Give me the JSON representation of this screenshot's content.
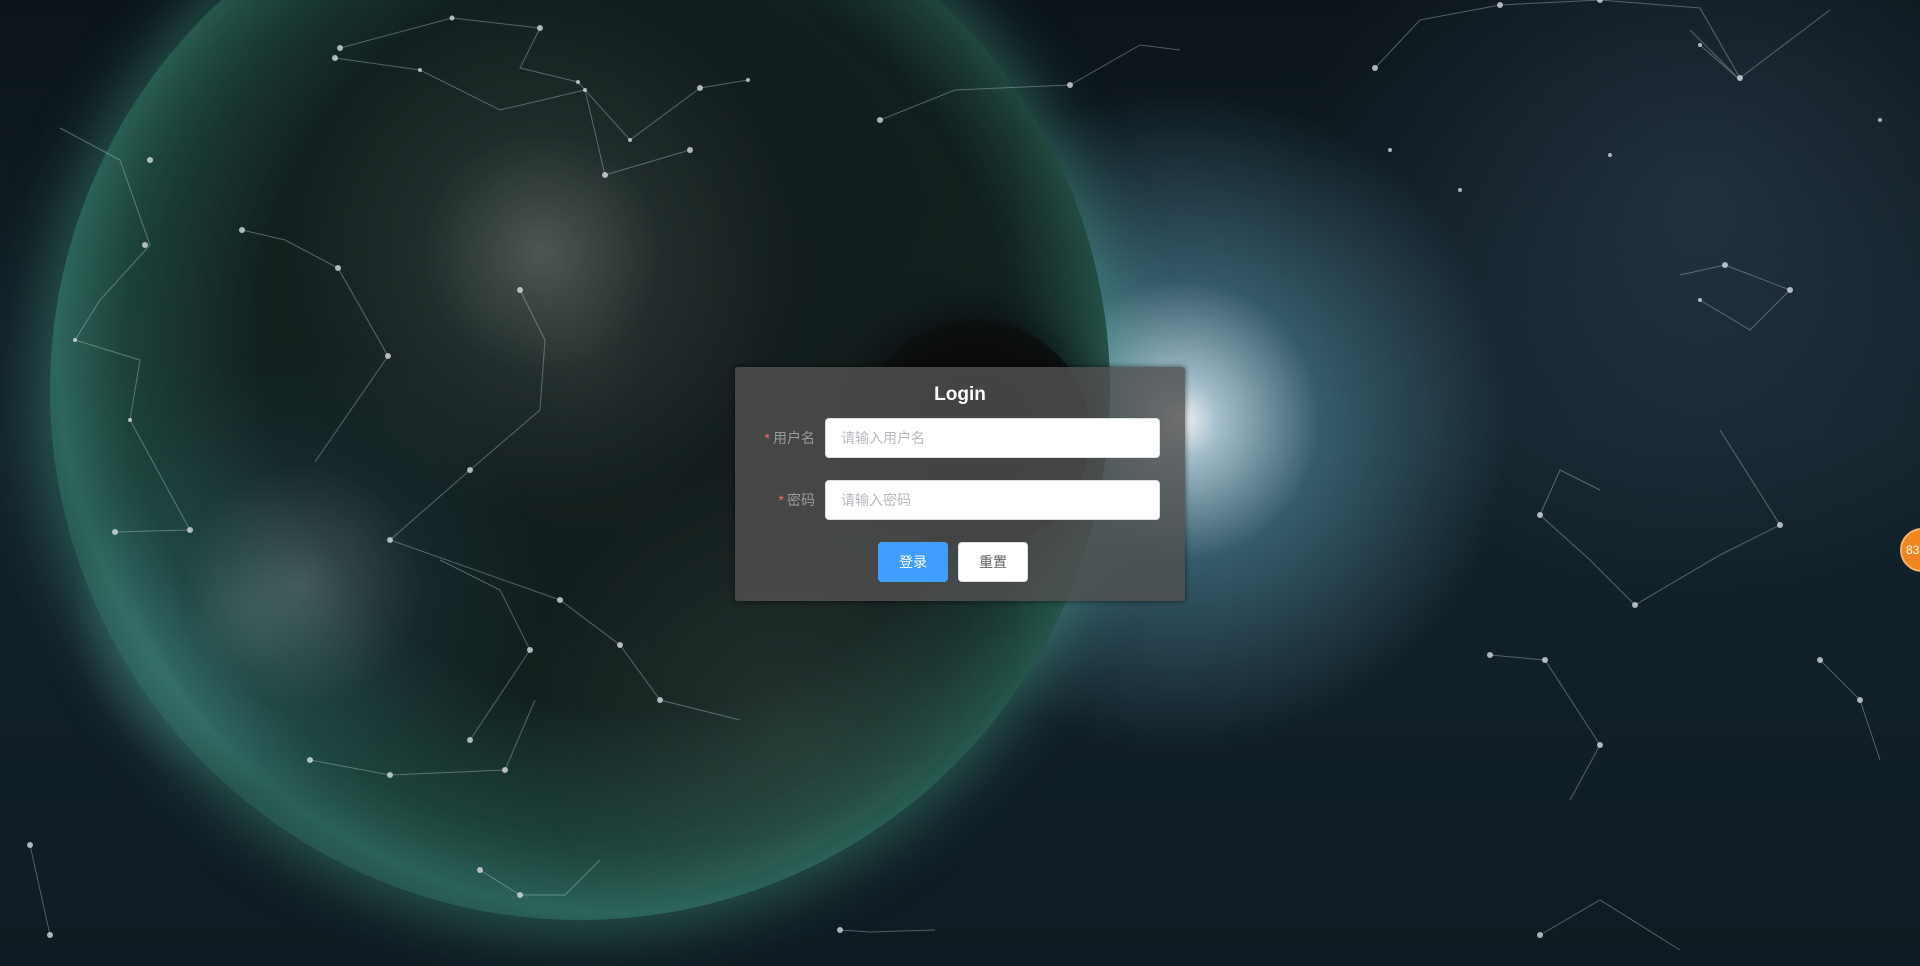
{
  "login": {
    "title": "Login",
    "username": {
      "required_mark": "*",
      "label": "用户名",
      "placeholder": "请输入用户名",
      "value": ""
    },
    "password": {
      "required_mark": "*",
      "label": "密码",
      "placeholder": "请输入密码",
      "value": ""
    },
    "buttons": {
      "login_label": "登录",
      "reset_label": "重置"
    }
  },
  "side_badge": {
    "text": "83"
  },
  "colors": {
    "primary": "#409eff",
    "required": "#f56c6c",
    "badge": "#f0861e"
  }
}
